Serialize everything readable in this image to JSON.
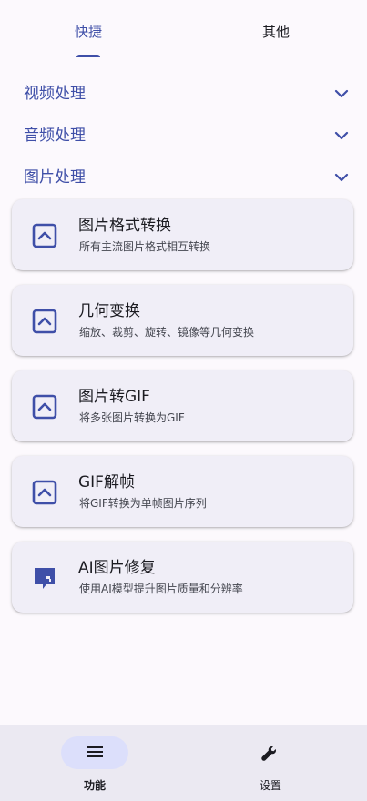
{
  "tabs": [
    {
      "label": "快捷",
      "active": true
    },
    {
      "label": "其他",
      "active": false
    }
  ],
  "sections": [
    {
      "label": "视频处理",
      "icon": "chevron-down-icon",
      "expanded": false
    },
    {
      "label": "音频处理",
      "icon": "chevron-down-icon",
      "expanded": false
    },
    {
      "label": "图片处理",
      "icon": "chevron-down-icon",
      "expanded": true
    }
  ],
  "cards": [
    {
      "title": "图片格式转换",
      "description": "所有主流图片格式相互转换",
      "icon": "image-icon"
    },
    {
      "title": "几何变换",
      "description": "缩放、裁剪、旋转、镜像等几何变换",
      "icon": "image-icon"
    },
    {
      "title": "图片转GIF",
      "description": "将多张图片转换为GIF",
      "icon": "image-icon"
    },
    {
      "title": "GIF解帧",
      "description": "将GIF转换为单帧图片序列",
      "icon": "image-icon"
    },
    {
      "title": "AI图片修复",
      "description": "使用AI模型提升图片质量和分辨率",
      "icon": "ai-comment-icon"
    }
  ],
  "bottom_nav": [
    {
      "label": "功能",
      "icon": "menu-icon",
      "active": true
    },
    {
      "label": "设置",
      "icon": "wrench-icon",
      "active": false
    }
  ],
  "colors": {
    "accent": "#3f4fa8",
    "background": "#fcf9fd",
    "card": "#f0eef7",
    "nav_background": "#ebe9f2",
    "nav_indicator": "#dcdffb"
  }
}
